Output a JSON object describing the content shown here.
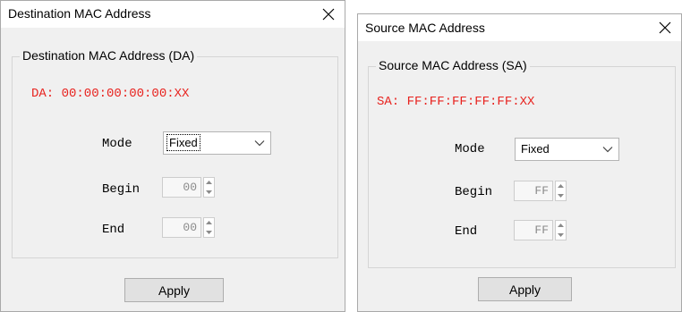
{
  "dest_dialog": {
    "title": "Destination MAC Address",
    "group_label": "Destination MAC Address (DA)",
    "mac_text": "DA: 00:00:00:00:00:XX",
    "mode_label": "Mode",
    "mode_value": "Fixed",
    "begin_label": "Begin",
    "begin_value": "00",
    "end_label": "End",
    "end_value": "00",
    "apply_label": "Apply"
  },
  "src_dialog": {
    "title": "Source MAC Address",
    "group_label": "Source MAC Address (SA)",
    "mac_text": "SA: FF:FF:FF:FF:FF:XX",
    "mode_label": "Mode",
    "mode_value": "Fixed",
    "begin_label": "Begin",
    "begin_value": "FF",
    "end_label": "End",
    "end_value": "FF",
    "apply_label": "Apply"
  },
  "colors": {
    "mac_text": "#e8231f",
    "dialog_bg": "#f0f0f0"
  },
  "icons": [
    "close-icon",
    "chevron-down-icon",
    "spin-up-icon",
    "spin-down-icon"
  ]
}
